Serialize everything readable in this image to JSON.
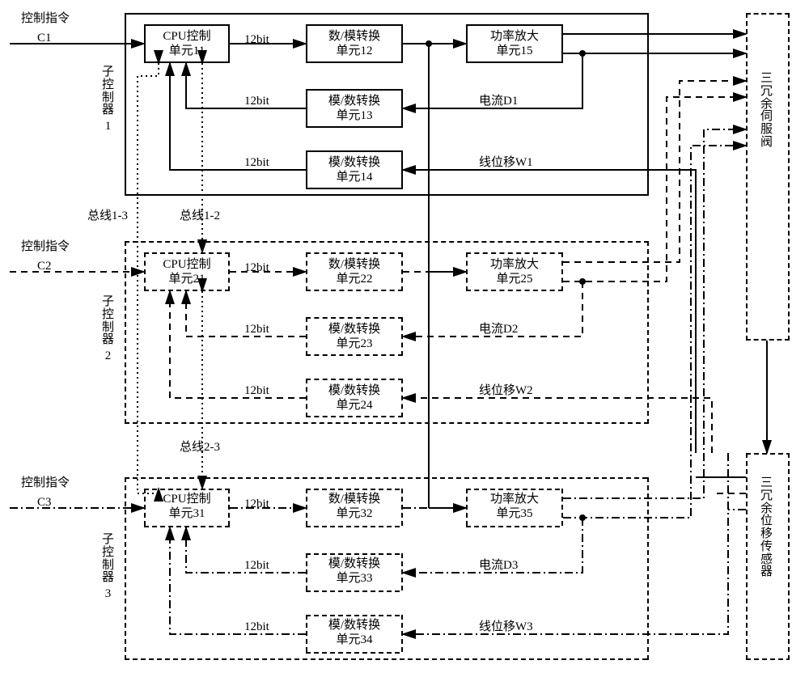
{
  "inputs": {
    "c1": {
      "label": "控制指令",
      "sig": "C1"
    },
    "c2": {
      "label": "控制指令",
      "sig": "C2"
    },
    "c3": {
      "label": "控制指令",
      "sig": "C3"
    }
  },
  "sub_controllers": [
    {
      "id": 1,
      "name": "子控制器",
      "num": "1",
      "cpu": {
        "l1": "CPU控制",
        "l2": "单元11"
      },
      "dac": {
        "l1": "数/模转换",
        "l2": "单元12"
      },
      "adc_i": {
        "l1": "模/数转换",
        "l2": "单元13"
      },
      "adc_w": {
        "l1": "模/数转换",
        "l2": "单元14"
      },
      "amp": {
        "l1": "功率放大",
        "l2": "单元15"
      },
      "bits": "12bit",
      "current": "电流D1",
      "disp": "线位移W1"
    },
    {
      "id": 2,
      "name": "子控制器",
      "num": "2",
      "cpu": {
        "l1": "CPU控制",
        "l2": "单元21"
      },
      "dac": {
        "l1": "数/模转换",
        "l2": "单元22"
      },
      "adc_i": {
        "l1": "模/数转换",
        "l2": "单元23"
      },
      "adc_w": {
        "l1": "模/数转换",
        "l2": "单元24"
      },
      "amp": {
        "l1": "功率放大",
        "l2": "单元25"
      },
      "bits": "12bit",
      "current": "电流D2",
      "disp": "线位移W2"
    },
    {
      "id": 3,
      "name": "子控制器",
      "num": "3",
      "cpu": {
        "l1": "CPU控制",
        "l2": "单元31"
      },
      "dac": {
        "l1": "数/模转换",
        "l2": "单元32"
      },
      "adc_i": {
        "l1": "模/数转换",
        "l2": "单元33"
      },
      "adc_w": {
        "l1": "模/数转换",
        "l2": "单元34"
      },
      "amp": {
        "l1": "功率放大",
        "l2": "单元35"
      },
      "bits": "12bit",
      "current": "电流D3",
      "disp": "线位移W3"
    }
  ],
  "buses": {
    "b13": "总线1-3",
    "b12": "总线1-2",
    "b23": "总线2-3"
  },
  "right": {
    "servo": "三冗余伺服阀",
    "sensor": "三冗余位移传感器"
  }
}
